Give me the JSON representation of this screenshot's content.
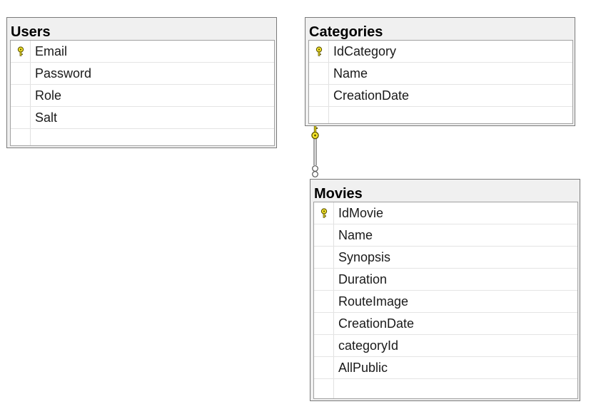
{
  "tables": {
    "users": {
      "title": "Users",
      "columns": [
        {
          "name": "Email",
          "primary_key": true
        },
        {
          "name": "Password",
          "primary_key": false
        },
        {
          "name": "Role",
          "primary_key": false
        },
        {
          "name": "Salt",
          "primary_key": false
        }
      ]
    },
    "categories": {
      "title": "Categories",
      "columns": [
        {
          "name": "IdCategory",
          "primary_key": true
        },
        {
          "name": "Name",
          "primary_key": false
        },
        {
          "name": "CreationDate",
          "primary_key": false
        }
      ]
    },
    "movies": {
      "title": "Movies",
      "columns": [
        {
          "name": "IdMovie",
          "primary_key": true
        },
        {
          "name": "Name",
          "primary_key": false
        },
        {
          "name": "Synopsis",
          "primary_key": false
        },
        {
          "name": "Duration",
          "primary_key": false
        },
        {
          "name": "RouteImage",
          "primary_key": false
        },
        {
          "name": "CreationDate",
          "primary_key": false
        },
        {
          "name": "categoryId",
          "primary_key": false
        },
        {
          "name": "AllPublic",
          "primary_key": false
        }
      ]
    }
  },
  "relationship": {
    "from": "Categories",
    "to": "Movies",
    "from_end": "one",
    "to_end": "many"
  },
  "colors": {
    "box_background": "#f0f0f0",
    "box_border": "#7a7a7a",
    "grid_border": "#a0a0a0",
    "key_fill": "#f5e52a",
    "key_stroke": "#5c5300",
    "connector": "#707070"
  },
  "icons": {
    "primary_key": "key-icon"
  }
}
